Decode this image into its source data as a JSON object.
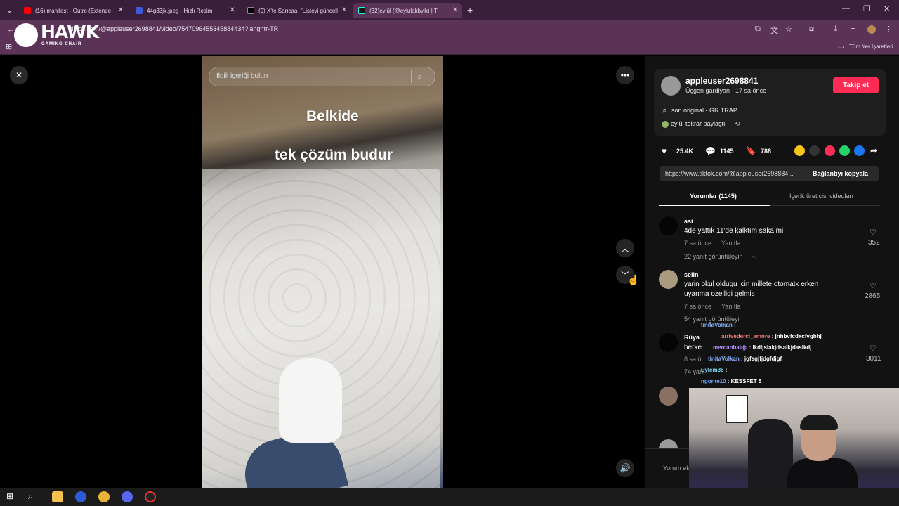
{
  "browser": {
    "tabs": [
      {
        "label": "(16) manifest - Outro (Extende",
        "color": "#ff0000"
      },
      {
        "label": "44g33jk.jpeg - Hızlı Resim",
        "color": "#3b5bdb"
      },
      {
        "label": "(9) X'te Sarıcaa: \"Listeyi güncell",
        "color": "#000000"
      },
      {
        "label": "(32)eylül (@eylulakbyik) | Ti",
        "color": "#111111"
      }
    ],
    "url": "tiktok.com/@appleuser2698841/video/7547096455345884434?lang=tr-TR",
    "bookmarks_label": "Tüm Yer İşaretleri"
  },
  "overlay_logo": {
    "brand": "HAWK",
    "sub": "GAMING CHAIR"
  },
  "video": {
    "search_placeholder": "İlgili içeriği bulun",
    "caption_line1": "Belkide",
    "caption_line2": "tek çözüm budur"
  },
  "author": {
    "username": "appleuser2698841",
    "subtitle": "Üçgen gardiyan · 17 sa önce",
    "follow_label": "Takip et",
    "sound": "son original - GR TRAP",
    "repost": "eylül tekrar paylaştı"
  },
  "stats": {
    "likes": "25.4K",
    "comments": "1145",
    "saves": "788"
  },
  "link": {
    "url": "https://www.tiktok.com/@appleuser2698884...",
    "copy_label": "Bağlantıyı kopyala"
  },
  "tabs": {
    "comments": "Yorumlar (1145)",
    "creator_videos": "İçerik üreticisi videoları"
  },
  "comments": [
    {
      "user": "asi",
      "text": "4de yattık 11'de kalktım saka mi",
      "time": "7 sa önce",
      "reply": "Yanıtla",
      "likes": "352",
      "replies": "22 yanıt görüntüleyin"
    },
    {
      "user": "selin",
      "text": "yarin okul oldugu icin millete otomatk erken",
      "text2": "uyanma ozelligi gelmis",
      "time": "7 sa önce",
      "reply": "Yanıtla",
      "likes": "2865",
      "replies": "54 yanıt görüntüleyin"
    },
    {
      "user": "Rüya",
      "text": "herke",
      "time": "8 sa ö",
      "likes": "3011",
      "replies": "74 yanı"
    }
  ],
  "chat": [
    {
      "user": "tinitaVolkan",
      "msg": ":",
      "color": "#8ab4ff"
    },
    {
      "user": "arrivederci_amore",
      "msg": ": jnhbvfcdxcfvgbhj",
      "color": "#ff7a7a"
    },
    {
      "user": "mercanbalığı",
      "msg": ": lkdijslakjdsalkjdaslkdj",
      "color": "#b48cff"
    },
    {
      "user": "tinitaVolkan",
      "msg": ": jgfsgjfjdgfdjgf",
      "color": "#8ab4ff"
    },
    {
      "user": "Eylem35",
      "msg": ":",
      "color": "#7ee0ff"
    },
    {
      "user": "ngonte10",
      "msg": ": KESSFET 5",
      "color": "#6aa8ff"
    }
  ],
  "comment_input": "Yorum ek",
  "colors": {
    "accent": "#fe2c55",
    "browser": "#5a3357"
  }
}
